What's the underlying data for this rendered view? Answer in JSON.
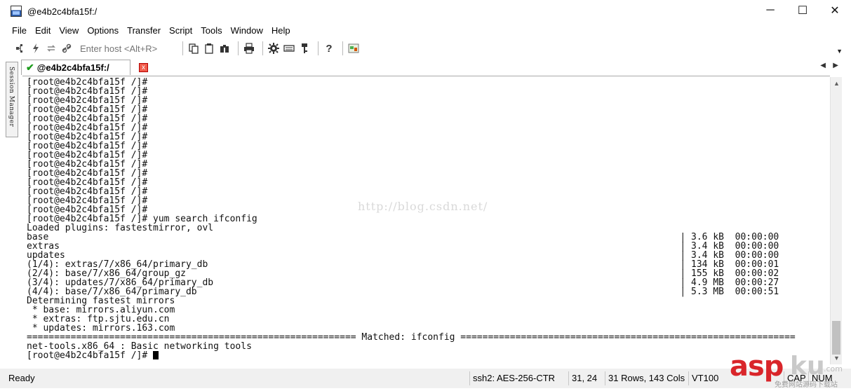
{
  "window": {
    "title": "@e4b2c4bfa15f:/",
    "controls": [
      "─",
      "☐",
      "✕"
    ]
  },
  "menu": [
    "File",
    "Edit",
    "View",
    "Options",
    "Transfer",
    "Script",
    "Tools",
    "Window",
    "Help"
  ],
  "toolbar": {
    "host_placeholder": "Enter host <Alt+R>"
  },
  "session_manager_label": "Session Manager",
  "tab": {
    "label": "@e4b2c4bfa15f:/",
    "close": "x"
  },
  "terminal": {
    "watermark": "http://blog.csdn.net/",
    "lines": [
      "[root@e4b2c4bfa15f /]#",
      "[root@e4b2c4bfa15f /]#",
      "[root@e4b2c4bfa15f /]#",
      "[root@e4b2c4bfa15f /]#",
      "[root@e4b2c4bfa15f /]#",
      "[root@e4b2c4bfa15f /]#",
      "[root@e4b2c4bfa15f /]#",
      "[root@e4b2c4bfa15f /]#",
      "[root@e4b2c4bfa15f /]#",
      "[root@e4b2c4bfa15f /]#",
      "[root@e4b2c4bfa15f /]#",
      "[root@e4b2c4bfa15f /]#",
      "[root@e4b2c4bfa15f /]#",
      "[root@e4b2c4bfa15f /]#",
      "[root@e4b2c4bfa15f /]#",
      "[root@e4b2c4bfa15f /]# yum search ifconfig",
      "Loaded plugins: fastestmirror, ovl",
      "base                                                                                                                   | 3.6 kB  00:00:00",
      "extras                                                                                                                 | 3.4 kB  00:00:00",
      "updates                                                                                                                | 3.4 kB  00:00:00",
      "(1/4): extras/7/x86_64/primary_db                                                                                      | 134 kB  00:00:01",
      "(2/4): base/7/x86_64/group_gz                                                                                          | 155 kB  00:00:02",
      "(3/4): updates/7/x86_64/primary_db                                                                                     | 4.9 MB  00:00:27",
      "(4/4): base/7/x86_64/primary_db                                                                                        | 5.3 MB  00:00:51",
      "Determining fastest mirrors",
      " * base: mirrors.aliyun.com",
      " * extras: ftp.sjtu.edu.cn",
      " * updates: mirrors.163.com",
      "============================================================ Matched: ifconfig =============================================================",
      "net-tools.x86_64 : Basic networking tools"
    ],
    "prompt": "[root@e4b2c4bfa15f /]# "
  },
  "status": {
    "ready": "Ready",
    "cipher": "ssh2: AES-256-CTR",
    "position": "31,  24",
    "size": "31 Rows, 143 Cols",
    "terminal_type": "VT100",
    "caps": "CAP",
    "num": "NUM"
  },
  "overlay_logo": {
    "asp": "asp",
    "ku": "ku",
    "com": ".com",
    "sub": "免费网站源码下载站"
  }
}
